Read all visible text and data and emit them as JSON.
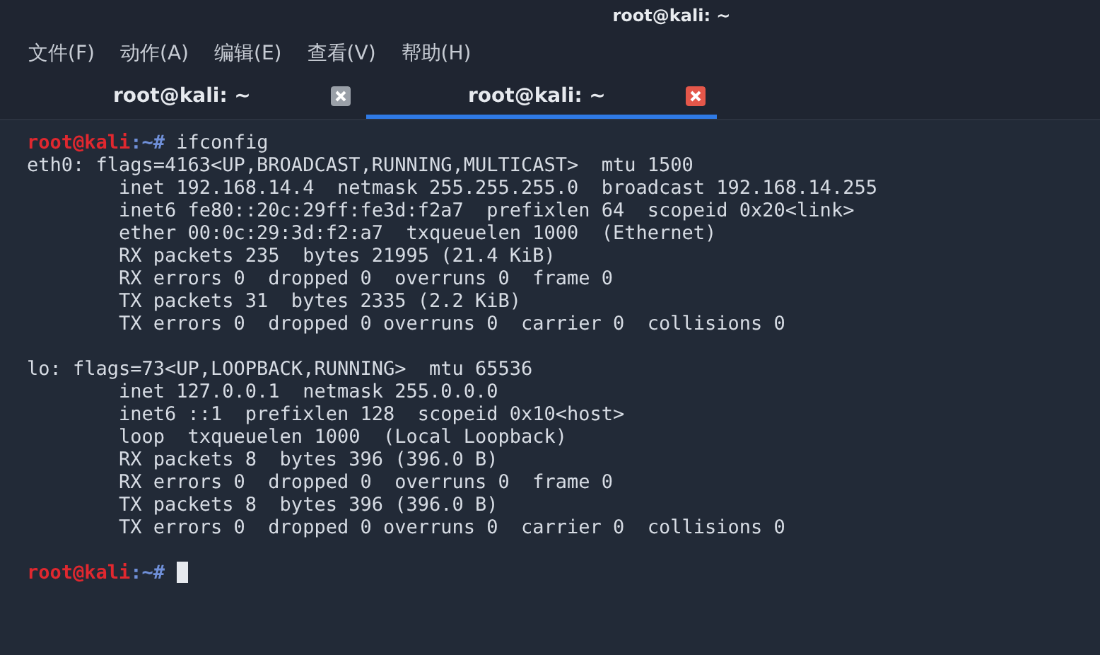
{
  "window": {
    "title": "root@kali: ~"
  },
  "menu": [
    {
      "label": "文件(F)"
    },
    {
      "label": "动作(A)"
    },
    {
      "label": "编辑(E)"
    },
    {
      "label": "查看(V)"
    },
    {
      "label": "帮助(H)"
    }
  ],
  "tabs": [
    {
      "label": "root@kali: ~",
      "selected": false
    },
    {
      "label": "root@kali: ~",
      "selected": true
    }
  ],
  "terminal": {
    "lines": [
      {
        "kind": "prompt",
        "user": "root@kali",
        "path": ":~",
        "symbol": "#",
        "command": "ifconfig"
      },
      {
        "kind": "output",
        "text": "eth0: flags=4163<UP,BROADCAST,RUNNING,MULTICAST>  mtu 1500"
      },
      {
        "kind": "output",
        "text": "        inet 192.168.14.4  netmask 255.255.255.0  broadcast 192.168.14.255"
      },
      {
        "kind": "output",
        "text": "        inet6 fe80::20c:29ff:fe3d:f2a7  prefixlen 64  scopeid 0x20<link>"
      },
      {
        "kind": "output",
        "text": "        ether 00:0c:29:3d:f2:a7  txqueuelen 1000  (Ethernet)"
      },
      {
        "kind": "output",
        "text": "        RX packets 235  bytes 21995 (21.4 KiB)"
      },
      {
        "kind": "output",
        "text": "        RX errors 0  dropped 0  overruns 0  frame 0"
      },
      {
        "kind": "output",
        "text": "        TX packets 31  bytes 2335 (2.2 KiB)"
      },
      {
        "kind": "output",
        "text": "        TX errors 0  dropped 0 overruns 0  carrier 0  collisions 0"
      },
      {
        "kind": "blank"
      },
      {
        "kind": "output",
        "text": "lo: flags=73<UP,LOOPBACK,RUNNING>  mtu 65536"
      },
      {
        "kind": "output",
        "text": "        inet 127.0.0.1  netmask 255.0.0.0"
      },
      {
        "kind": "output",
        "text": "        inet6 ::1  prefixlen 128  scopeid 0x10<host>"
      },
      {
        "kind": "output",
        "text": "        loop  txqueuelen 1000  (Local Loopback)"
      },
      {
        "kind": "output",
        "text": "        RX packets 8  bytes 396 (396.0 B)"
      },
      {
        "kind": "output",
        "text": "        RX errors 0  dropped 0  overruns 0  frame 0"
      },
      {
        "kind": "output",
        "text": "        TX packets 8  bytes 396 (396.0 B)"
      },
      {
        "kind": "output",
        "text": "        TX errors 0  dropped 0 overruns 0  carrier 0  collisions 0"
      },
      {
        "kind": "blank"
      },
      {
        "kind": "prompt",
        "user": "root@kali",
        "path": ":~",
        "symbol": "#",
        "cursor": true
      }
    ]
  }
}
